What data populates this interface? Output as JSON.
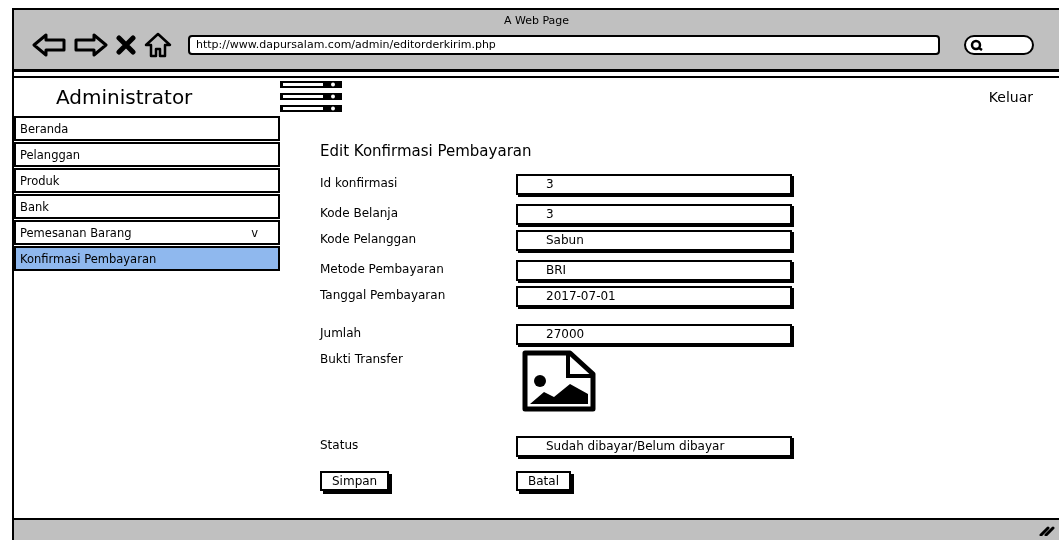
{
  "window": {
    "title": "A Web Page"
  },
  "browser": {
    "nav": [
      {
        "kind": "back"
      },
      {
        "kind": "forward"
      },
      {
        "kind": "stop"
      },
      {
        "kind": "home"
      }
    ],
    "url": "http://www.dapursalam.com/admin/editorderkirim.php"
  },
  "header": {
    "brand": "Administrator",
    "logout": "Keluar"
  },
  "sidebar": {
    "items": [
      {
        "label": "Beranda",
        "selected": false
      },
      {
        "label": "Pelanggan",
        "selected": false
      },
      {
        "label": "Produk",
        "selected": false
      },
      {
        "label": "Bank",
        "selected": false
      },
      {
        "label": "Pemesanan Barang",
        "selected": false,
        "caret": "v"
      },
      {
        "label": "Konfirmasi Pembayaran",
        "selected": true
      }
    ]
  },
  "form": {
    "title": "Edit Konfirmasi Pembayaran",
    "fields": [
      {
        "kind": "text",
        "label": "Id konfirmasi",
        "value": "3"
      },
      {
        "kind": "text",
        "label": "Kode Belanja",
        "value": "3"
      },
      {
        "kind": "text",
        "label": "Kode Pelanggan",
        "value": "Sabun"
      },
      {
        "kind": "text",
        "label": "Metode Pembayaran",
        "value": "BRI"
      },
      {
        "kind": "text",
        "label": "Tanggal Pembayaran",
        "value": "2017-07-01"
      },
      {
        "kind": "text",
        "label": "Jumlah",
        "value": "27000"
      },
      {
        "kind": "image",
        "label": "Bukti Transfer"
      },
      {
        "kind": "text",
        "label": "Status",
        "value": "Sudah dibayar/Belum dibayar"
      }
    ],
    "buttons": [
      "Simpan",
      "Batal"
    ]
  }
}
